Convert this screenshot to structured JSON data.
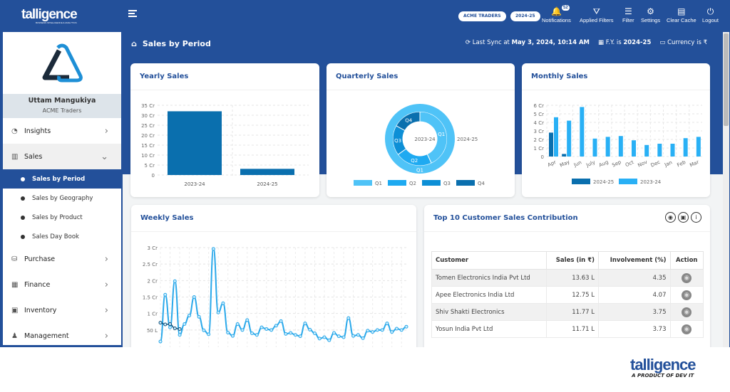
{
  "header": {
    "brand": "talligence",
    "brand_tagline": "BUSINESS INTELLIGENCE & ANALYTICS",
    "company_pill": "ACME TRADERS",
    "year_pill": "2024-25",
    "notifications_count": "52",
    "actions": [
      {
        "label": "Notifications",
        "icon": "bell-icon"
      },
      {
        "label": "Applied Filters",
        "icon": "funnel-icon"
      },
      {
        "label": "Filter",
        "icon": "sliders-icon"
      },
      {
        "label": "Settings",
        "icon": "gear-icon"
      },
      {
        "label": "Clear Cache",
        "icon": "clear-cache-icon"
      },
      {
        "label": "Logout",
        "icon": "logout-icon"
      }
    ]
  },
  "sidebar": {
    "user_name": "Uttam Mangukiya",
    "company": "ACME Traders",
    "items": [
      {
        "label": "Insights",
        "icon": "gauge-icon"
      },
      {
        "label": "Sales",
        "icon": "chart-icon"
      },
      {
        "label": "Purchase",
        "icon": "cash-icon"
      },
      {
        "label": "Finance",
        "icon": "calculator-icon"
      },
      {
        "label": "Inventory",
        "icon": "box-icon"
      },
      {
        "label": "Management",
        "icon": "team-icon"
      }
    ],
    "sales_sub": [
      "Sales by Period",
      "Sales by Geography",
      "Sales by Product",
      "Sales Day Book"
    ]
  },
  "page": {
    "title": "Sales by Period",
    "sync_prefix": "Last Sync at",
    "sync_value": "May 3, 2024, 10:14 AM",
    "fy_prefix": "F.Y. is",
    "fy_value": "2024-25",
    "currency": "Currency is ₹"
  },
  "colors": {
    "primary": "#23509a",
    "dark_bar": "#0a6fae",
    "light_bar": "#29b0f5"
  },
  "chart_data": [
    {
      "id": "yearly",
      "type": "bar",
      "title": "Yearly Sales",
      "categories": [
        "2023-24",
        "2024-25"
      ],
      "values": [
        32,
        3.1
      ],
      "unit": "Cr",
      "ylim": [
        0,
        35
      ],
      "ticks": [
        "0",
        "5 Cr",
        "10 Cr",
        "15 Cr",
        "20 Cr",
        "25 Cr",
        "30 Cr",
        "35 Cr"
      ],
      "grid": true
    },
    {
      "id": "quarterly",
      "type": "pie",
      "title": "Quarterly Sales",
      "rings": [
        {
          "name": "2023-24",
          "slices": [
            {
              "label": "Q1",
              "value": 43
            },
            {
              "label": "Q2",
              "value": 22
            },
            {
              "label": "Q3",
              "value": 18
            },
            {
              "label": "Q4",
              "value": 17
            }
          ]
        },
        {
          "name": "2024-25",
          "slices": [
            {
              "label": "Q1",
              "value": 100
            }
          ]
        }
      ],
      "legend": [
        "Q1",
        "Q2",
        "Q3",
        "Q4"
      ],
      "legend_position": "bottom",
      "colors": [
        "#4fc3f7",
        "#1eaaf1",
        "#0d8fd6",
        "#0a6fae"
      ]
    },
    {
      "id": "monthly",
      "type": "bar",
      "title": "Monthly Sales",
      "categories": [
        "Apr",
        "May",
        "Jun",
        "July",
        "Aug",
        "Sep",
        "Oct",
        "Nov",
        "Dec",
        "Jan",
        "Feb",
        "Mar"
      ],
      "series": [
        {
          "name": "2024-25",
          "values": [
            2.8,
            0.3,
            null,
            null,
            null,
            null,
            null,
            null,
            null,
            null,
            null,
            null
          ]
        },
        {
          "name": "2023-24",
          "values": [
            4.6,
            4.2,
            5.8,
            2.1,
            2.3,
            2.4,
            1.9,
            1.35,
            1.5,
            1.5,
            2.15,
            2.3
          ]
        }
      ],
      "unit": "Cr",
      "ylim": [
        0,
        6
      ],
      "ticks": [
        "0",
        "1 Cr",
        "2 Cr",
        "3 Cr",
        "4 Cr",
        "5 Cr",
        "6 Cr"
      ],
      "legend_position": "bottom",
      "grid": true
    },
    {
      "id": "weekly",
      "type": "line",
      "title": "Weekly Sales",
      "unit": "Cr",
      "ylim": [
        0,
        3
      ],
      "ticks": [
        {
          "v": 0.5,
          "label": "50 L"
        },
        {
          "v": 1,
          "label": "1 Cr"
        },
        {
          "v": 1.5,
          "label": "1.5 Cr"
        },
        {
          "v": 2,
          "label": "2 Cr"
        },
        {
          "v": 2.5,
          "label": "2.5 Cr"
        },
        {
          "v": 3,
          "label": "3 Cr"
        }
      ],
      "grid": true,
      "series": [
        {
          "color": "#29a8ea",
          "values": [
            0.15,
            1.57,
            0.58,
            1.98,
            0.35,
            0.68,
            0.94,
            1.5,
            0.9,
            0.49,
            0.37,
            2.96,
            1.03,
            1.31,
            0.42,
            0.32,
            0.68,
            0.5,
            0.8,
            0.4,
            0.35,
            0.58,
            0.53,
            0.5,
            0.63,
            0.77,
            0.38,
            0.41,
            0.35,
            0.31,
            0.7,
            0.51,
            0.4,
            0.24,
            0.28,
            0.19,
            0.41,
            0.31,
            0.28,
            0.86,
            0.32,
            0.35,
            0.25,
            0.48,
            0.44,
            0.5,
            0.5,
            0.7,
            0.44,
            0.54,
            0.5,
            0.6
          ]
        },
        {
          "color": "#0d4f7a",
          "values": [
            0.72,
            0.67,
            0.68,
            0.55,
            0.53
          ]
        }
      ]
    }
  ],
  "top_customers": {
    "title": "Top 10 Customer Sales Contribution",
    "columns": [
      "Customer",
      "Sales (in ₹)",
      "Involvement (%)",
      "Action"
    ],
    "rows": [
      [
        "Tomen Electronics India Pvt Ltd",
        "13.63 L",
        "4.35"
      ],
      [
        "Apee Electronics India Ltd",
        "12.75 L",
        "4.07"
      ],
      [
        "Shiv Shakti Electronics",
        "11.77 L",
        "3.75"
      ],
      [
        "Yosun India Pvt Ltd",
        "11.71 L",
        "3.73"
      ]
    ]
  },
  "footer": {
    "brand": "talligence",
    "tagline": "A PRODUCT OF DEV IT"
  }
}
